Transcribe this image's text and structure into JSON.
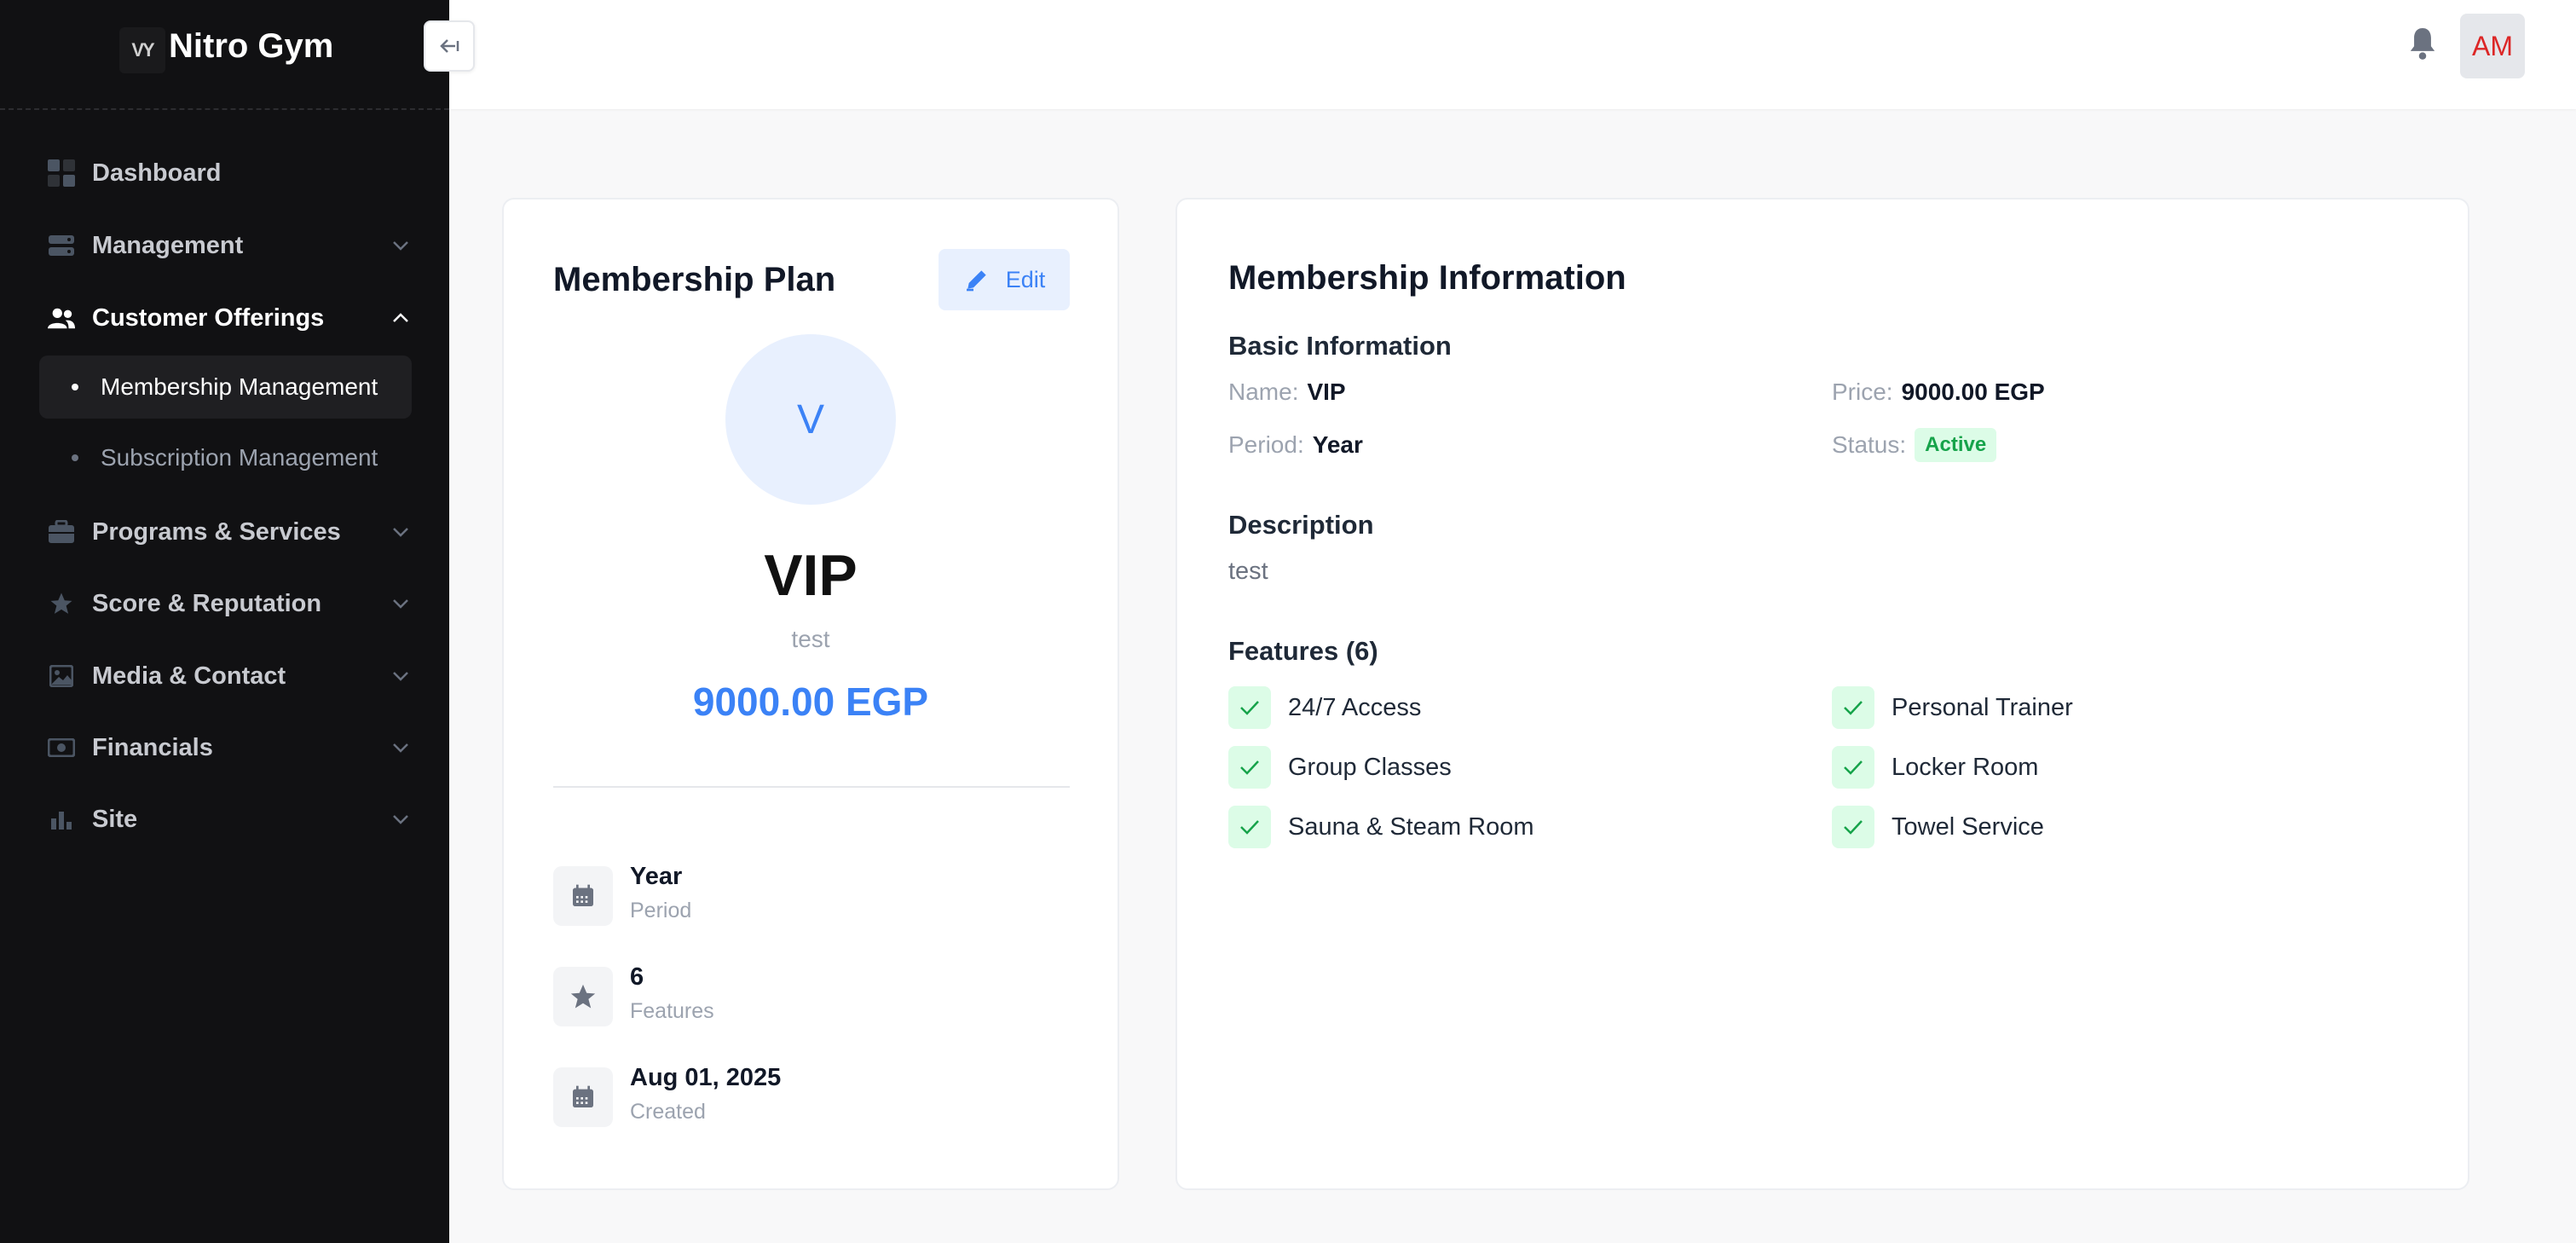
{
  "app": {
    "title": "Nitro Gym",
    "logo_text": "VY"
  },
  "sidebar": {
    "items": [
      {
        "label": "Dashboard"
      },
      {
        "label": "Management"
      },
      {
        "label": "Customer Offerings"
      },
      {
        "label": "Programs & Services"
      },
      {
        "label": "Score & Reputation"
      },
      {
        "label": "Media & Contact"
      },
      {
        "label": "Financials"
      },
      {
        "label": "Site"
      }
    ],
    "sub_items": [
      {
        "label": "Membership Management"
      },
      {
        "label": "Subscription Management"
      }
    ]
  },
  "header": {
    "avatar_initials": "AM"
  },
  "plan_card": {
    "title": "Membership Plan",
    "edit_label": "Edit",
    "initial": "V",
    "name": "VIP",
    "description": "test",
    "price": "9000.00 EGP",
    "stats": [
      {
        "value": "Year",
        "label": "Period"
      },
      {
        "value": "6",
        "label": "Features"
      },
      {
        "value": "Aug 01, 2025",
        "label": "Created"
      }
    ]
  },
  "info_card": {
    "title": "Membership Information",
    "basic_heading": "Basic Information",
    "name_label": "Name:",
    "name_value": "VIP",
    "price_label": "Price:",
    "price_value": "9000.00 EGP",
    "period_label": "Period:",
    "period_value": "Year",
    "status_label": "Status:",
    "status_value": "Active",
    "description_heading": "Description",
    "description_text": "test",
    "features_heading": "Features (6)",
    "features": [
      "24/7 Access",
      "Personal Trainer",
      "Group Classes",
      "Locker Room",
      "Sauna & Steam Room",
      "Towel Service"
    ]
  },
  "colors": {
    "sidebar_bg": "#111113",
    "accent": "#3b82f6",
    "success": "#16a34a"
  }
}
